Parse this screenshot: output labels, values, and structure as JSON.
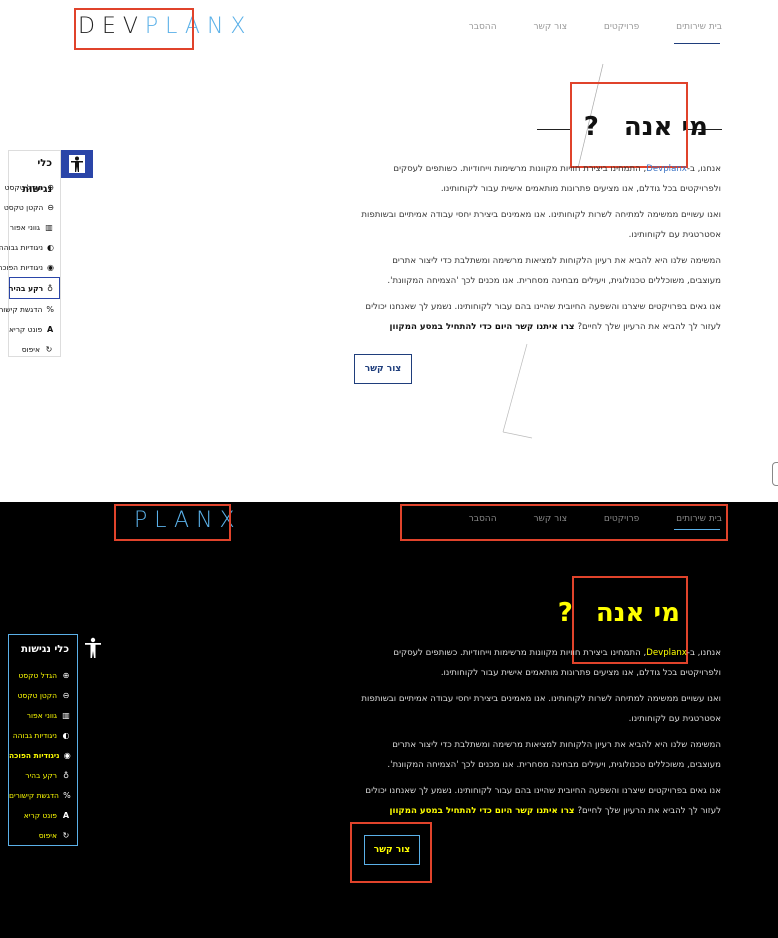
{
  "brand": {
    "logo_dark": "DEV",
    "logo_light": "PLANX"
  },
  "nav": {
    "items": [
      "בית",
      "שירותים",
      "פרויקטים",
      "צור קשר",
      "ההסבר"
    ]
  },
  "about": {
    "title_main": "מי אנה",
    "title_mark": "?",
    "p1_before": "אנחנו, ב-",
    "brand_name": "Devplanx",
    "p1_after": ", התמחינו ביצירת חוויות מקוונות מרשימות וייחודיות. כשותפים לעסקים ולפרויקטים בכל גודלם, אנו מציעים פתרונות מותאמים אישית עבור לקוחותינו.",
    "p2": "ואנו עשויים ממשימה למתיחה לשרות לקוחותינו. אנו מאמינים ביצירת יחסי עבודה אמיתיים ובשותפות אסטרטגית עם לקוחותינו.",
    "p3": "המשימה שלנו היא להביא את רעיון הלקוחות למציאות מרשימה ומשתלבת כדי ליצור אתרים מעוצבים, משוכללים טכנולוגית, ויעילים מבחינה מסחרית. אנו מכנים לכך 'הצמיחה המקוונת'.",
    "p4_normal": "אנו גאים בפרויקטים שיצרנו והשפעה החיובית שהיינו בהם עבור לקוחותינו. נשמע לך שאנחנו יכולים לעזור לך להביא את הרעיון שלך לחיים?",
    "p4_bold": " צרו איתנו קשר היום כדי להתחיל במסע המקוון",
    "cta": "צור קשר"
  },
  "accessibility": {
    "title": "כלי נגישות",
    "items": [
      {
        "label": "הגדל טקסט",
        "icon": "zoom-in-icon",
        "glyph": "⊕"
      },
      {
        "label": "הקטן טקסט",
        "icon": "zoom-out-icon",
        "glyph": "⊖"
      },
      {
        "label": "גווני אפור",
        "icon": "grayscale-icon",
        "glyph": "▥"
      },
      {
        "label": "ניגודיות גבוהה",
        "icon": "contrast-icon",
        "glyph": "◐"
      },
      {
        "label": "ניגודיות הפוכה",
        "icon": "eye-icon",
        "glyph": "◉"
      },
      {
        "label": "רקע בהיר",
        "icon": "bulb-icon",
        "glyph": "♁"
      },
      {
        "label": "הדגשת קישורים",
        "icon": "link-icon",
        "glyph": "%"
      },
      {
        "label": "פונט קריא",
        "icon": "font-icon",
        "glyph": "A"
      },
      {
        "label": "איפוס",
        "icon": "reset-icon",
        "glyph": "↻"
      }
    ]
  },
  "colors": {
    "accent_blue": "#1f3e7c",
    "link_blue": "#3a73c4",
    "highlight_yellow": "#ffff00",
    "annotation_red": "#e0432b",
    "logo_light": "#5ab0e8"
  }
}
